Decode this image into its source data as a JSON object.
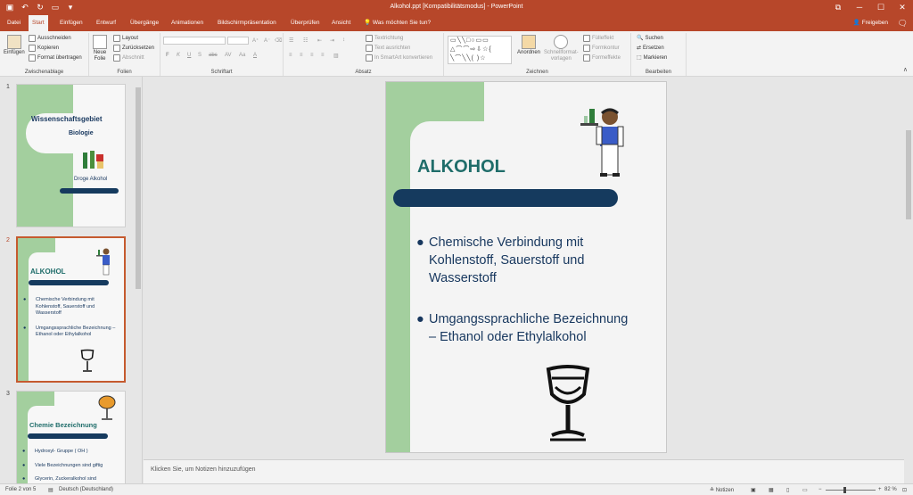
{
  "app": {
    "title": "Alkohol.ppt [Kompatibilitätsmodus] - PowerPoint",
    "accent_color": "#b7472a"
  },
  "quick_access": {
    "save_icon": "save-icon",
    "undo_icon": "undo-icon",
    "redo_icon": "redo-icon",
    "start_icon": "present-icon",
    "more_icon": "more-icon"
  },
  "window_buttons": {
    "ribbon_options": "⧉",
    "minimize": "─",
    "maximize": "☐",
    "close": "✕"
  },
  "tabs": [
    {
      "label": "Datei"
    },
    {
      "label": "Start"
    },
    {
      "label": "Einfügen"
    },
    {
      "label": "Entwurf"
    },
    {
      "label": "Übergänge"
    },
    {
      "label": "Animationen"
    },
    {
      "label": "Bildschirmpräsentation"
    },
    {
      "label": "Überprüfen"
    },
    {
      "label": "Ansicht"
    }
  ],
  "tell_me": "Was möchten Sie tun?",
  "share": "Freigeben",
  "ribbon": {
    "clipboard": {
      "label": "Zwischenablage",
      "paste": "Einfügen",
      "cut": "Ausschneiden",
      "copy": "Kopieren",
      "format_painter": "Format übertragen"
    },
    "slides": {
      "label": "Folien",
      "new_slide": "Neue",
      "new_slide2": "Folie",
      "layout": "Layout",
      "reset": "Zurücksetzen",
      "section": "Abschnitt"
    },
    "font": {
      "label": "Schriftart",
      "bold": "F",
      "italic": "K",
      "underline": "U",
      "shadow": "S",
      "strike": "abc",
      "spacing": "AV",
      "case": "Aa",
      "color": "A"
    },
    "paragraph": {
      "label": "Absatz",
      "text_direction": "Textrichtung",
      "align_text": "Text ausrichten",
      "smartart": "In SmartArt konvertieren"
    },
    "drawing": {
      "label": "Zeichnen",
      "arrange": "Anordnen",
      "quick_styles": "Schnellformat-",
      "quick_styles2": "vorlagen",
      "fill": "Fülleffekt",
      "outline": "Formkontur",
      "effects": "Formeffekte"
    },
    "editing": {
      "label": "Bearbeiten",
      "find": "Suchen",
      "replace": "Ersetzen",
      "select": "Markieren"
    }
  },
  "thumbnails": [
    {
      "num": "1",
      "title": "Wissenschaftsgebiet",
      "subtitle": "Biologie",
      "caption": "Droge Alkohol"
    },
    {
      "num": "2",
      "title": "ALKOHOL",
      "bullet1": "Chemische Verbindung mit Kohlenstoff, Sauerstoff und Wasserstoff",
      "bullet2": "Umgangssprachliche Bezeichnung – Ethanol oder Ethylalkohol"
    },
    {
      "num": "3",
      "title": "Chemie Bezeichnung",
      "bullet1": "Hydroxyl- Gruppe ( OH )",
      "bullet2": "Viele Bezeichnungen sind giftig",
      "bullet3": "Glycerin, Zuckeralkohol sind"
    }
  ],
  "slide": {
    "title": "ALKOHOL",
    "bullets": [
      "Chemische Verbindung mit Kohlenstoff, Sauerstoff und Wasserstoff",
      "Umgangssprachliche Bezeichnung – Ethanol oder Ethylalkohol"
    ],
    "accent_green": "#a3cf9e",
    "bar_color": "#153a5e",
    "title_color": "#1f6d6a",
    "text_color": "#17375e"
  },
  "notes_placeholder": "Klicken Sie, um Notizen hinzuzufügen",
  "status": {
    "slide_counter": "Folie 2 von 5",
    "language": "Deutsch (Deutschland)",
    "notes": "Notizen",
    "zoom": "82 %"
  }
}
